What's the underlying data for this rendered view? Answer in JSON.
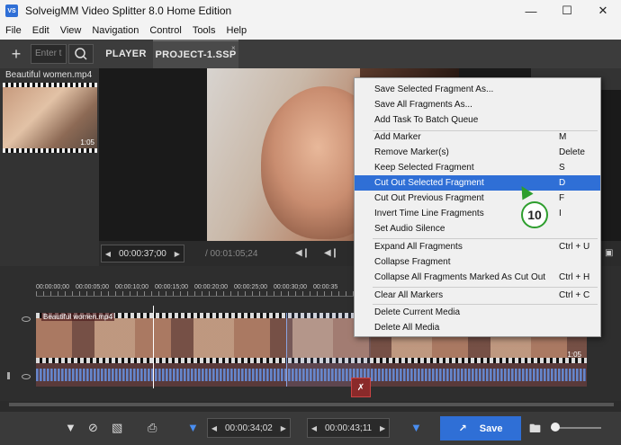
{
  "window": {
    "title": "SolveigMM Video Splitter 8.0 Home Edition",
    "app_icon_text": "VS"
  },
  "menu": [
    "File",
    "Edit",
    "View",
    "Navigation",
    "Control",
    "Tools",
    "Help"
  ],
  "toolbar": {
    "search_placeholder": "Enter t"
  },
  "tabs": [
    {
      "label": "PLAYER"
    },
    {
      "label": "PROJECT-1.SSP",
      "close": "×"
    }
  ],
  "media": {
    "name": "Beautiful women.mp4",
    "duration": "1:05"
  },
  "transport": {
    "current": "00:00:37;00",
    "total": "/ 00:01:05;24"
  },
  "timeline": {
    "ruler_labels": [
      "00:00:00;00",
      "00:00:05;00",
      "00:00:10;00",
      "00:00:15;00",
      "00:00:20;00",
      "00:00:25;00",
      "00:00:30;00",
      "00:00:35"
    ],
    "track_label": "Beautiful women.mp4",
    "track_duration": "1:05"
  },
  "bottom": {
    "start_tc": "00:00:34;02",
    "end_tc": "00:00:43;11",
    "save_label": "Save"
  },
  "context_menu": [
    {
      "label": "Save Selected Fragment As...",
      "key": ""
    },
    {
      "label": "Save All Fragments As...",
      "key": ""
    },
    {
      "label": "Add Task To Batch Queue",
      "key": ""
    },
    {
      "sep": true
    },
    {
      "label": "Add Marker",
      "key": "M"
    },
    {
      "label": "Remove Marker(s)",
      "key": "Delete"
    },
    {
      "label": "Keep Selected Fragment",
      "key": "S"
    },
    {
      "label": "Cut Out Selected Fragment",
      "key": "D",
      "highlight": true
    },
    {
      "label": "Cut Out Previous Fragment",
      "key": "F"
    },
    {
      "label": "Invert Time Line Fragments",
      "key": "I"
    },
    {
      "label": "Set Audio Silence",
      "key": ""
    },
    {
      "sep": true
    },
    {
      "label": "Expand All Fragments",
      "key": "Ctrl + U"
    },
    {
      "label": "Collapse Fragment",
      "key": ""
    },
    {
      "label": "Collapse All Fragments Marked As Cut Out",
      "key": "Ctrl + H"
    },
    {
      "sep": true
    },
    {
      "label": "Clear All Markers",
      "key": "Ctrl + C"
    },
    {
      "sep": true
    },
    {
      "label": "Delete Current Media",
      "key": ""
    },
    {
      "label": "Delete All Media",
      "key": ""
    }
  ],
  "callout": {
    "number": "10"
  },
  "colors": {
    "accent": "#2f6fd6",
    "callout": "#2e9e2e"
  }
}
